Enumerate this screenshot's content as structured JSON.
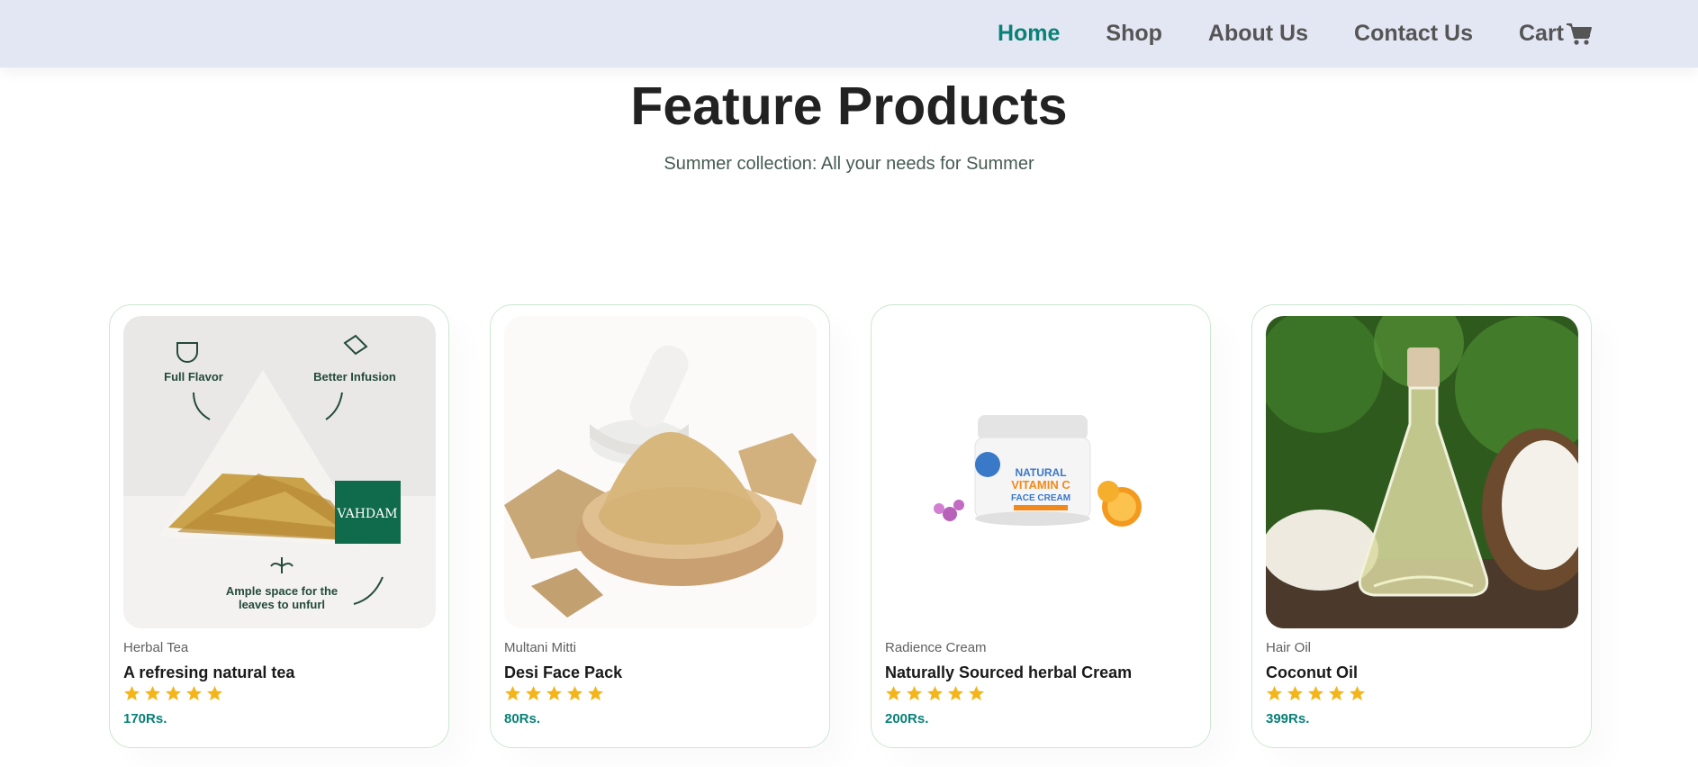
{
  "nav": {
    "items": [
      {
        "label": "Home",
        "active": true
      },
      {
        "label": "Shop",
        "active": false
      },
      {
        "label": "About Us",
        "active": false
      },
      {
        "label": "Contact Us",
        "active": false
      },
      {
        "label": "Cart",
        "active": false
      }
    ],
    "cart_icon": "shopping-cart-icon"
  },
  "feature": {
    "title": "Feature Products",
    "subtitle": "Summer collection: All your needs for Summer"
  },
  "products": [
    {
      "brand": "Herbal Tea",
      "name": "A refresing natural tea",
      "price": "170Rs.",
      "rating": 5,
      "image": {
        "icon": "tea-bag-image",
        "labels": {
          "flavor": "Full Flavor",
          "infusion": "Better Infusion",
          "space_1": "Ample space for the",
          "space_2": "leaves to unfurl",
          "logo": "VAHDAM"
        }
      }
    },
    {
      "brand": "Multani Mitti",
      "name": "Desi Face Pack",
      "price": "80Rs.",
      "rating": 5,
      "image": {
        "icon": "clay-powder-bowl-image"
      }
    },
    {
      "brand": "Radience Cream",
      "name": "Naturally Sourced herbal Cream",
      "price": "200Rs.",
      "rating": 5,
      "image": {
        "icon": "face-cream-jar-image",
        "labels": {
          "line1": "NATURAL",
          "line2": "VITAMIN C",
          "line3": "FACE CREAM"
        }
      }
    },
    {
      "brand": "Hair Oil",
      "name": "Coconut Oil",
      "price": "399Rs.",
      "rating": 5,
      "image": {
        "icon": "coconut-oil-bottle-image"
      }
    }
  ],
  "colors": {
    "accent": "#088178",
    "header_bg": "#e3e6f3",
    "star": "#f3b519",
    "card_border": "#cce7d0"
  }
}
